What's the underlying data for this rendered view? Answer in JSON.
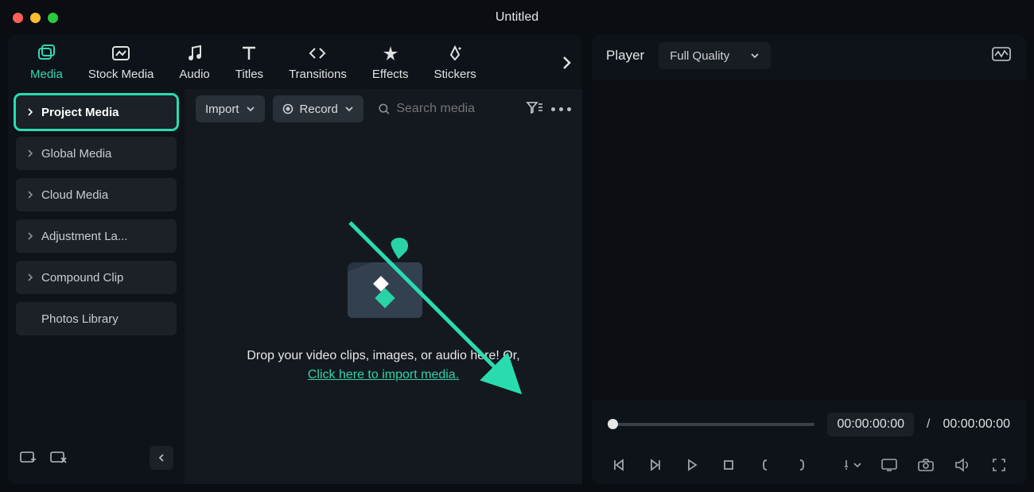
{
  "window": {
    "title": "Untitled"
  },
  "tabs": [
    {
      "id": "media",
      "label": "Media",
      "active": true
    },
    {
      "id": "stock",
      "label": "Stock Media"
    },
    {
      "id": "audio",
      "label": "Audio"
    },
    {
      "id": "titles",
      "label": "Titles"
    },
    {
      "id": "transitions",
      "label": "Transitions"
    },
    {
      "id": "effects",
      "label": "Effects"
    },
    {
      "id": "stickers",
      "label": "Stickers"
    }
  ],
  "sidebar": {
    "items": [
      {
        "label": "Project Media",
        "selected": true,
        "expandable": true
      },
      {
        "label": "Global Media",
        "expandable": true
      },
      {
        "label": "Cloud Media",
        "expandable": true
      },
      {
        "label": "Adjustment La...",
        "expandable": true
      },
      {
        "label": "Compound Clip",
        "expandable": true
      },
      {
        "label": "Photos Library",
        "expandable": false
      }
    ]
  },
  "toolbar": {
    "import": "Import",
    "record": "Record",
    "search_placeholder": "Search media"
  },
  "dropzone": {
    "line1": "Drop your video clips, images, or audio here! Or,",
    "link": "Click here to import media."
  },
  "player": {
    "label": "Player",
    "quality": "Full Quality",
    "current": "00:00:00:00",
    "sep": "/",
    "total": "00:00:00:00"
  },
  "colors": {
    "accent": "#29dcb0"
  }
}
